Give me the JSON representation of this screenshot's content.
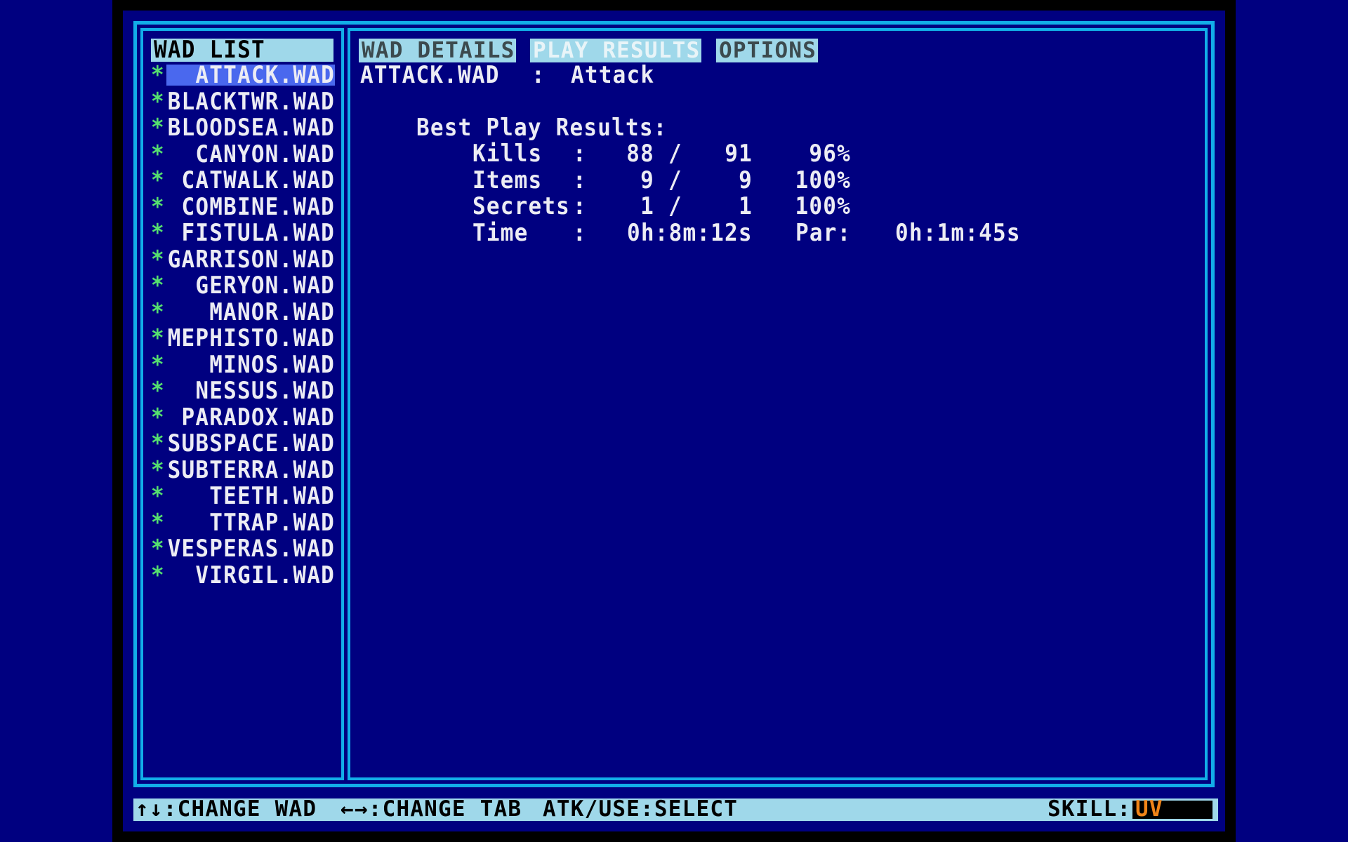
{
  "colors": {
    "background": "#000080",
    "frame_line": "#12aee8",
    "header_bg": "#9fd8ea",
    "selection_bg": "#4a68ee",
    "asterisk": "#55e06e",
    "skill_value": "#f08418",
    "text": "#ececf4"
  },
  "wad_list": {
    "title": "WAD LIST",
    "selected_index": 0,
    "items": [
      {
        "marker": "*",
        "label": "ATTACK.WAD"
      },
      {
        "marker": "*",
        "label": "BLACKTWR.WAD"
      },
      {
        "marker": "*",
        "label": "BLOODSEA.WAD"
      },
      {
        "marker": "*",
        "label": "CANYON.WAD"
      },
      {
        "marker": "*",
        "label": "CATWALK.WAD"
      },
      {
        "marker": "*",
        "label": "COMBINE.WAD"
      },
      {
        "marker": "*",
        "label": "FISTULA.WAD"
      },
      {
        "marker": "*",
        "label": "GARRISON.WAD"
      },
      {
        "marker": "*",
        "label": "GERYON.WAD"
      },
      {
        "marker": "*",
        "label": "MANOR.WAD"
      },
      {
        "marker": "*",
        "label": "MEPHISTO.WAD"
      },
      {
        "marker": "*",
        "label": "MINOS.WAD"
      },
      {
        "marker": "*",
        "label": "NESSUS.WAD"
      },
      {
        "marker": "*",
        "label": "PARADOX.WAD"
      },
      {
        "marker": "*",
        "label": "SUBSPACE.WAD"
      },
      {
        "marker": "*",
        "label": "SUBTERRA.WAD"
      },
      {
        "marker": "*",
        "label": "TEETH.WAD"
      },
      {
        "marker": "*",
        "label": "TTRAP.WAD"
      },
      {
        "marker": "*",
        "label": "VESPERAS.WAD"
      },
      {
        "marker": "*",
        "label": "VIRGIL.WAD"
      }
    ]
  },
  "tabs": [
    {
      "label": "WAD DETAILS",
      "active": false
    },
    {
      "label": "PLAY RESULTS",
      "active": true
    },
    {
      "label": "OPTIONS",
      "active": false
    }
  ],
  "details": {
    "filename": "ATTACK.WAD",
    "separator": ":",
    "title": "Attack",
    "section_title": "Best Play Results:",
    "stats": [
      {
        "label": "Kills",
        "colon": ":",
        "got": "88",
        "slash": "/",
        "total": "91",
        "percent": "96%"
      },
      {
        "label": "Items",
        "colon": ":",
        "got": "9",
        "slash": "/",
        "total": "9",
        "percent": "100%"
      },
      {
        "label": "Secrets",
        "colon": ":",
        "got": "1",
        "slash": "/",
        "total": "1",
        "percent": "100%"
      }
    ],
    "time": {
      "label": "Time",
      "colon": ":",
      "value": "0h:8m:12s",
      "par_label": "Par:",
      "par_value": "0h:1m:45s"
    }
  },
  "footer": {
    "hints": [
      "↑↓:CHANGE WAD",
      "←→:CHANGE TAB",
      "ATK/USE:SELECT"
    ],
    "skill_label": "SKILL:",
    "skill_value": "UV"
  }
}
